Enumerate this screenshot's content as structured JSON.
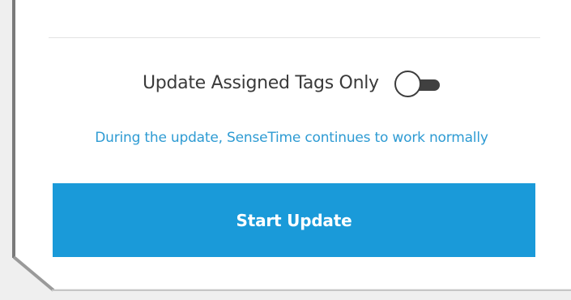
{
  "update_panel": {
    "toggle_label": "Update Assigned Tags Only",
    "toggle_state": "off",
    "info_text": "During the update, SenseTime continues to work normally",
    "start_button_label": "Start Update"
  },
  "colors": {
    "accent": "#1a9ad9",
    "info_text": "#2e9bd3",
    "toggle_track": "#404040",
    "panel_background": "#ffffff",
    "page_background": "#efefef"
  }
}
